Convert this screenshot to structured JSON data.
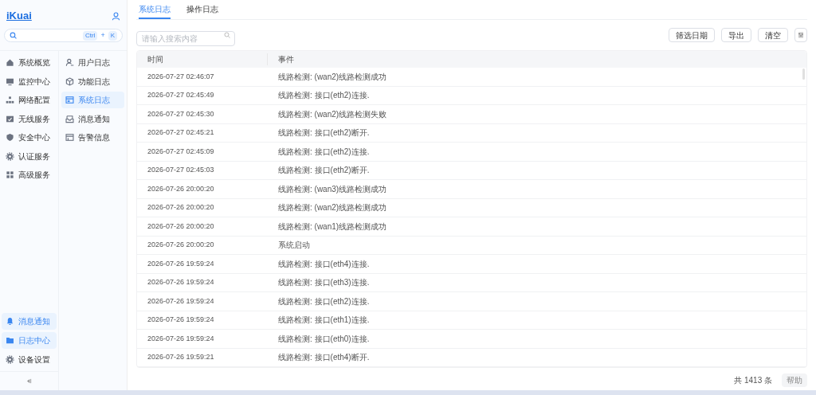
{
  "logo": "iKuai",
  "search": {
    "shortcut": [
      "Ctrl",
      "+",
      "K"
    ]
  },
  "main_nav": [
    {
      "label": "系统概览",
      "kind": "home",
      "selected": false
    },
    {
      "label": "监控中心",
      "kind": "monitor",
      "selected": false
    },
    {
      "label": "网络配置",
      "kind": "network",
      "selected": false
    },
    {
      "label": "无线服务",
      "kind": "wifi",
      "selected": false
    },
    {
      "label": "安全中心",
      "kind": "shield",
      "selected": false
    },
    {
      "label": "认证服务",
      "kind": "gear",
      "selected": false
    },
    {
      "label": "高级服务",
      "kind": "grid",
      "selected": false
    }
  ],
  "bottom_nav": [
    {
      "label": "消息通知",
      "kind": "bell",
      "selected": true
    },
    {
      "label": "日志中心",
      "kind": "folder",
      "selected": true
    },
    {
      "label": "设备设置",
      "kind": "gear",
      "selected": false
    }
  ],
  "sub_nav": [
    {
      "label": "用户日志",
      "kind": "user",
      "selected": false
    },
    {
      "label": "功能日志",
      "kind": "cube",
      "selected": false
    },
    {
      "label": "系统日志",
      "kind": "window",
      "selected": true
    },
    {
      "label": "消息通知",
      "kind": "inbox",
      "selected": false
    },
    {
      "label": "告警信息",
      "kind": "alert",
      "selected": false
    }
  ],
  "tabs": [
    {
      "label": "系统日志",
      "selected": true
    },
    {
      "label": "操作日志",
      "selected": false
    }
  ],
  "filter": {
    "placeholder": "请输入搜索内容"
  },
  "buttons": [
    "筛选日期",
    "导出",
    "清空"
  ],
  "table": {
    "columns": [
      "时间",
      "事件"
    ],
    "rows": [
      [
        "2026-07-27 02:46:07",
        "线路检测: (wan2)线路检测成功"
      ],
      [
        "2026-07-27 02:45:49",
        "线路检测: 接口(eth2)连接."
      ],
      [
        "2026-07-27 02:45:30",
        "线路检测: (wan2)线路检测失败"
      ],
      [
        "2026-07-27 02:45:21",
        "线路检测: 接口(eth2)断开."
      ],
      [
        "2026-07-27 02:45:09",
        "线路检测: 接口(eth2)连接."
      ],
      [
        "2026-07-27 02:45:03",
        "线路检测: 接口(eth2)断开."
      ],
      [
        "2026-07-26 20:00:20",
        "线路检测: (wan3)线路检测成功"
      ],
      [
        "2026-07-26 20:00:20",
        "线路检测: (wan2)线路检测成功"
      ],
      [
        "2026-07-26 20:00:20",
        "线路检测: (wan1)线路检测成功"
      ],
      [
        "2026-07-26 20:00:20",
        "系统启动"
      ],
      [
        "2026-07-26 19:59:24",
        "线路检测: 接口(eth4)连接."
      ],
      [
        "2026-07-26 19:59:24",
        "线路检测: 接口(eth3)连接."
      ],
      [
        "2026-07-26 19:59:24",
        "线路检测: 接口(eth2)连接."
      ],
      [
        "2026-07-26 19:59:24",
        "线路检测: 接口(eth1)连接."
      ],
      [
        "2026-07-26 19:59:24",
        "线路检测: 接口(eth0)连接."
      ],
      [
        "2026-07-26 19:59:21",
        "线路检测: 接口(eth4)断开."
      ]
    ]
  },
  "footer": {
    "total": "共 1413 条",
    "help": "帮助"
  }
}
